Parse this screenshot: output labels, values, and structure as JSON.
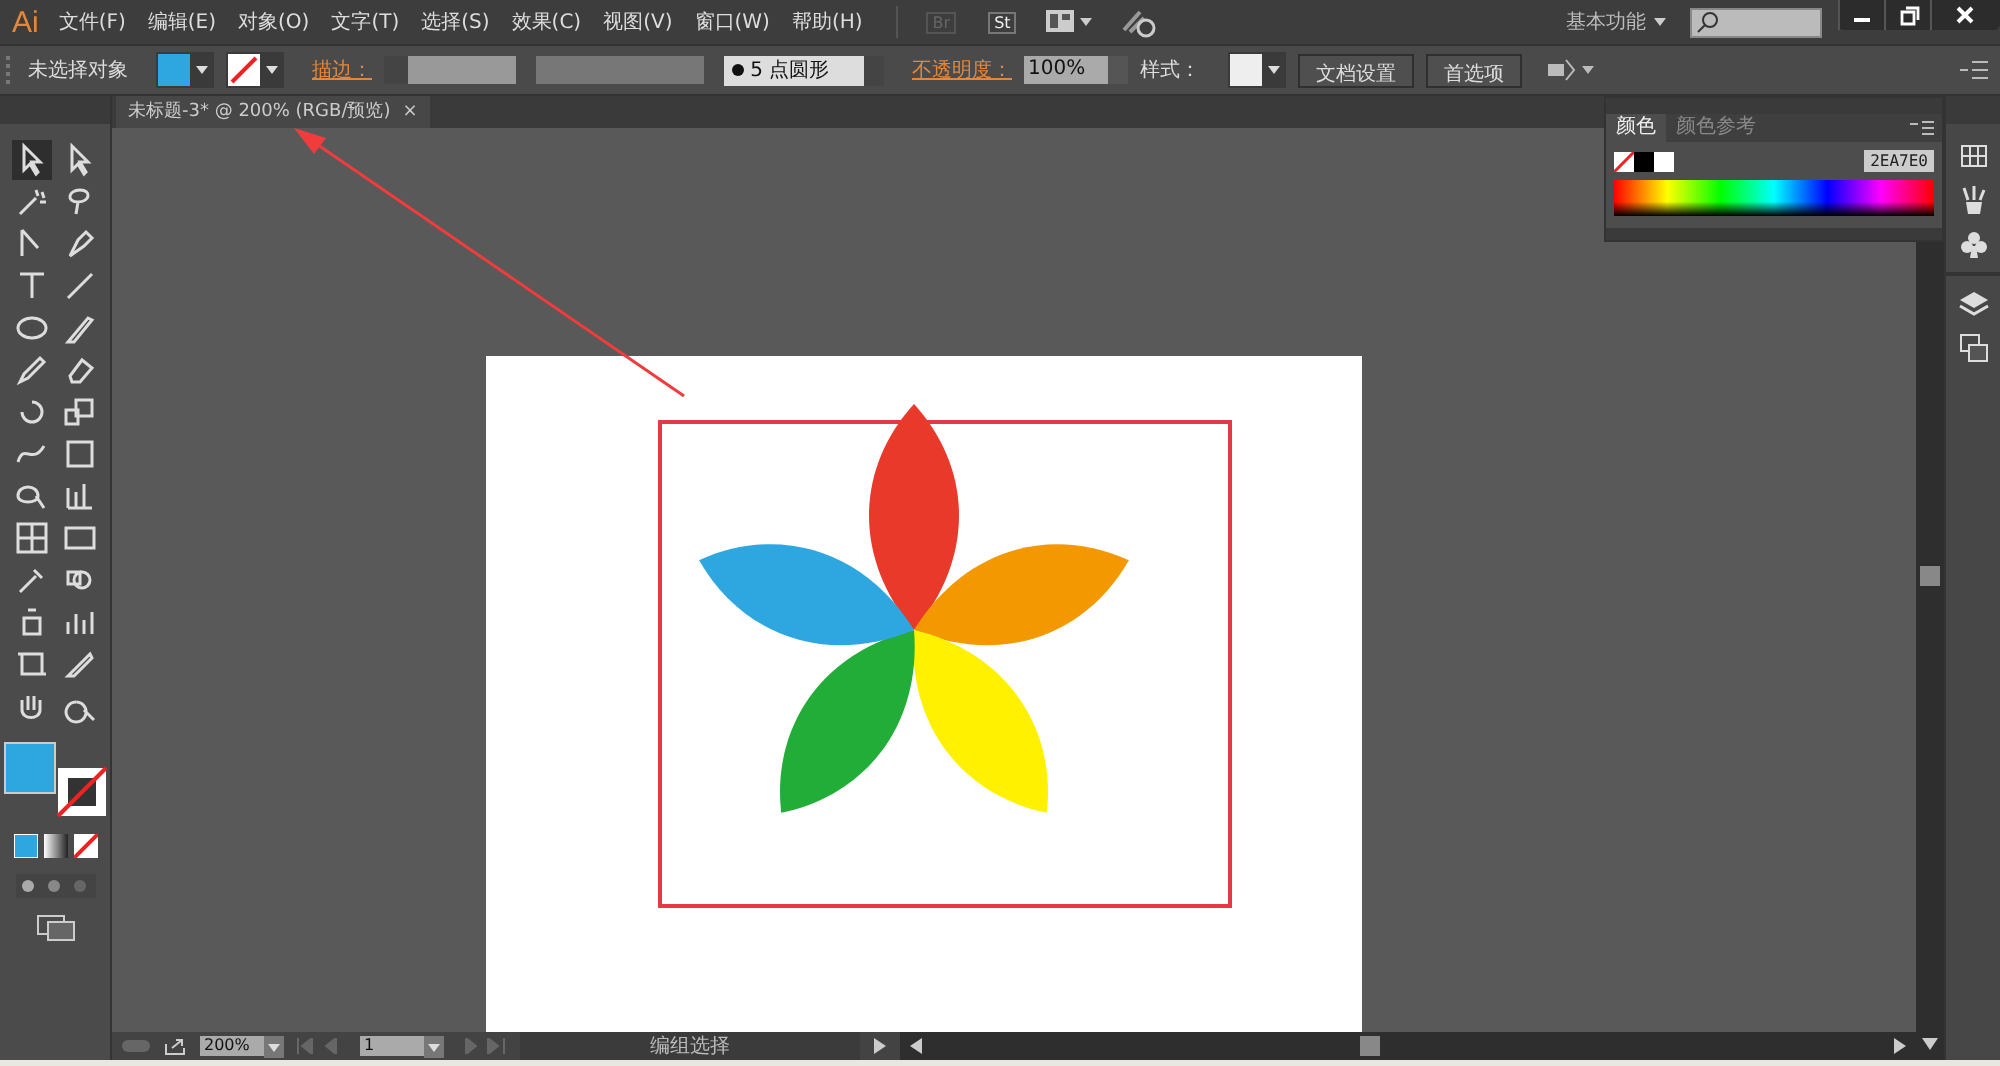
{
  "app_logo": "Ai",
  "menu": [
    "文件(F)",
    "编辑(E)",
    "对象(O)",
    "文字(T)",
    "选择(S)",
    "效果(C)",
    "视图(V)",
    "窗口(W)",
    "帮助(H)"
  ],
  "app_buttons": [
    "Br",
    "St"
  ],
  "workspace": "基本功能",
  "control_bar": {
    "selection": "未选择对象",
    "stroke_label": "描边：",
    "brush": "5 点圆形",
    "opacity_label": "不透明度：",
    "opacity": "100%",
    "style_label": "样式：",
    "buttons": [
      "文档设置",
      "首选项"
    ]
  },
  "document_tab": {
    "title": "未标题-3* @ 200% (RGB/预览)",
    "close": "×"
  },
  "tools": [
    {
      "selected": true
    },
    {
      "selected": false
    },
    {
      "selected": false
    },
    {
      "selected": false
    },
    {
      "selected": false
    },
    {
      "selected": false
    },
    {
      "selected": false
    },
    {
      "selected": false
    },
    {
      "selected": false
    },
    {
      "selected": false
    },
    {
      "selected": false
    },
    {
      "selected": false
    },
    {
      "selected": false
    },
    {
      "selected": false
    },
    {
      "selected": false
    },
    {
      "selected": false
    },
    {
      "selected": false
    },
    {
      "selected": false
    },
    {
      "selected": false
    },
    {
      "selected": false
    },
    {
      "selected": false
    },
    {
      "selected": false
    },
    {
      "selected": false
    },
    {
      "selected": false
    }
  ],
  "color_panel": {
    "tabs": [
      {
        "label": "颜色",
        "selected": true
      },
      {
        "label": "颜色参考",
        "selected": false
      }
    ],
    "hex": "2EA7E0"
  },
  "status_bar": {
    "zoom": "200%",
    "page": "1",
    "tool": "编组选择"
  }
}
